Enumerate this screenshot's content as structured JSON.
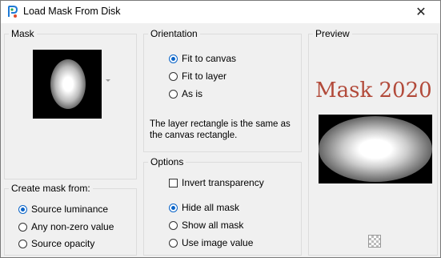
{
  "window": {
    "title": "Load Mask From Disk",
    "close_glyph": "✕"
  },
  "mask": {
    "label": "Mask"
  },
  "create": {
    "label": "Create mask from:",
    "options": [
      {
        "label": "Source luminance",
        "selected": true
      },
      {
        "label": "Any non-zero value",
        "selected": false
      },
      {
        "label": "Source opacity",
        "selected": false
      }
    ]
  },
  "orientation": {
    "label": "Orientation",
    "options": [
      {
        "label": "Fit to canvas",
        "selected": true
      },
      {
        "label": "Fit to layer",
        "selected": false
      },
      {
        "label": "As is",
        "selected": false
      }
    ],
    "hint": "The layer rectangle is the same as the canvas rectangle."
  },
  "options": {
    "label": "Options",
    "invert": {
      "label": "Invert transparency",
      "checked": false
    },
    "radios": [
      {
        "label": "Hide all mask",
        "selected": true
      },
      {
        "label": "Show all mask",
        "selected": false
      },
      {
        "label": "Use image value",
        "selected": false
      }
    ]
  },
  "preview": {
    "label": "Preview",
    "watermark": "Mask 2020"
  },
  "colors": {
    "accent": "#0a64c8",
    "watermark": "#b24a3a"
  },
  "icons": [
    "app-icon",
    "close-icon",
    "checkerboard-icon",
    "dropdown-arrow-icon"
  ]
}
